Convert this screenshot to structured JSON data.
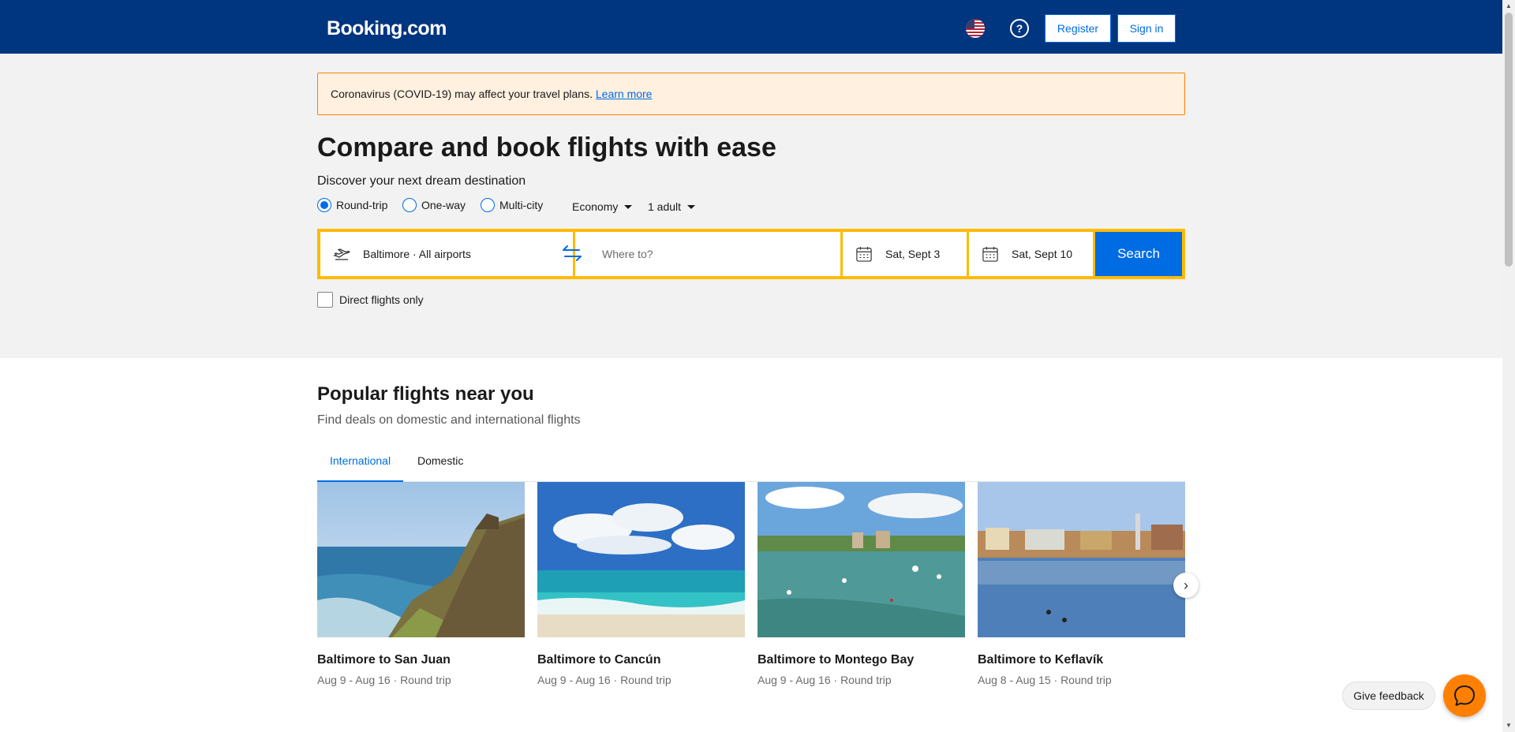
{
  "header": {
    "logo": "Booking.com",
    "register_label": "Register",
    "signin_label": "Sign in",
    "icons": [
      "us-flag-icon",
      "help-icon"
    ]
  },
  "alert": {
    "text": "Coronavirus (COVID-19) may affect your travel plans.",
    "link": "Learn more"
  },
  "hero": {
    "title": "Compare and book flights with ease",
    "subtitle": "Discover your next dream destination"
  },
  "trip_options": {
    "types": [
      {
        "label": "Round-trip",
        "selected": true
      },
      {
        "label": "One-way",
        "selected": false
      },
      {
        "label": "Multi-city",
        "selected": false
      }
    ],
    "cabin": "Economy",
    "passengers": "1 adult"
  },
  "search": {
    "from": "Baltimore · All airports",
    "to_placeholder": "Where to?",
    "depart": "Sat, Sept 3",
    "return": "Sat, Sept 10",
    "button": "Search",
    "direct_only": "Direct flights only",
    "direct_only_checked": false
  },
  "popular": {
    "title": "Popular flights near you",
    "subtitle": "Find deals on domestic and international flights",
    "tabs": [
      "International",
      "Domestic"
    ],
    "active_tab": "International",
    "cards": [
      {
        "title": "Baltimore to San Juan",
        "meta": "Aug 9 - Aug 16 · Round trip"
      },
      {
        "title": "Baltimore to Cancún",
        "meta": "Aug 9 - Aug 16 · Round trip"
      },
      {
        "title": "Baltimore to Montego Bay",
        "meta": "Aug 9 - Aug 16 · Round trip"
      },
      {
        "title": "Baltimore to Keflavík",
        "meta": "Aug 8 - Aug 15 · Round trip"
      }
    ]
  },
  "widgets": {
    "feedback": "Give feedback"
  },
  "colors": {
    "brand": "#003580",
    "accent": "#006ce4",
    "search_border": "#febb02",
    "alert_bg": "#fff0e0",
    "chat": "#ff8000"
  }
}
